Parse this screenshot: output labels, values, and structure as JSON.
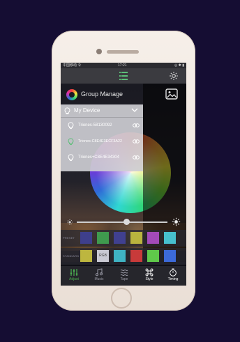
{
  "status_bar": {
    "carrier": "中国移动 令",
    "time": "17:21",
    "right": "◎ ✱ ▮"
  },
  "header": {
    "group_label": "Group Manage"
  },
  "device_menu": {
    "title": "My Device",
    "devices": [
      {
        "name": "Triones-58130092"
      },
      {
        "name": "Triones-C8E4E3ECF3A22"
      },
      {
        "name": "Triones+C8E4E34304"
      }
    ]
  },
  "palette": {
    "preset_label": "PRESET",
    "standard_label": "STANDARD",
    "preset_colors": [
      "#3e3f8c",
      "#3f9a4e",
      "#404090",
      "#b9b43e",
      "#a24ab9",
      "#47c0cf"
    ],
    "standard_colors": [
      "#bdb63f",
      "#c9c9d3",
      "#3fb3c3",
      "#c83a3a",
      "#5fc94a",
      "#3c6ad9"
    ],
    "standard_rgb_label": "RGB"
  },
  "tabs": [
    {
      "label": "Adjust",
      "icon": "sliders-icon",
      "active": true
    },
    {
      "label": "Music",
      "icon": "music-note-icon",
      "active": false
    },
    {
      "label": "Tape",
      "icon": "waves-icon",
      "active": false
    },
    {
      "label": "Style",
      "icon": "command-icon",
      "active": false
    },
    {
      "label": "Timing",
      "icon": "timer-icon",
      "active": false
    }
  ],
  "colors": {
    "active_tab": "#4caf50",
    "inactive_tab": "#9a9aa6",
    "white_tab": "#ffffff"
  },
  "brightness": {
    "level": 0.55
  }
}
